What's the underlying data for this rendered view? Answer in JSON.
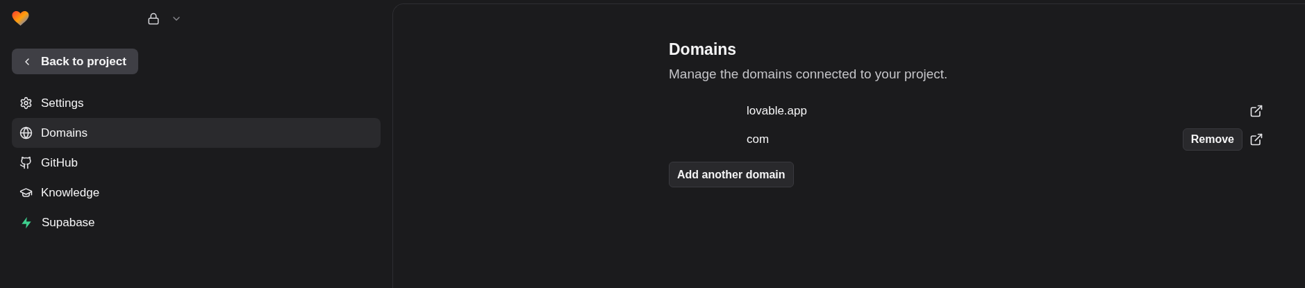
{
  "sidebar": {
    "back_button": "Back to project",
    "items": [
      {
        "label": "Settings",
        "selected": false
      },
      {
        "label": "Domains",
        "selected": true
      },
      {
        "label": "GitHub",
        "selected": false
      },
      {
        "label": "Knowledge",
        "selected": false
      },
      {
        "label": "Supabase",
        "selected": false
      }
    ]
  },
  "main": {
    "title": "Domains",
    "subtitle": "Manage the domains connected to your project.",
    "domains": [
      {
        "name": "lovable.app"
      },
      {
        "name": "com",
        "remove_button": "Remove"
      }
    ],
    "add_button": "Add another domain"
  }
}
